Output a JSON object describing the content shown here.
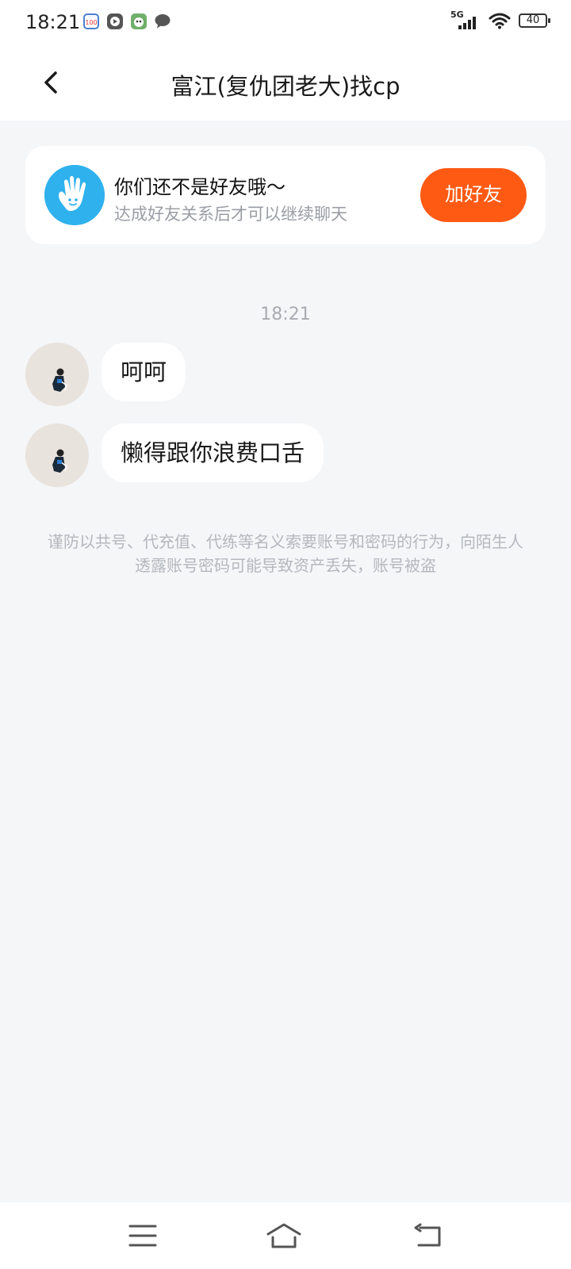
{
  "status_bar": {
    "time": "18:21",
    "network": "5G",
    "battery": "40",
    "notification_icons": [
      "calendar-app-icon",
      "video-play-icon",
      "game-app-icon",
      "message-bubble-icon"
    ]
  },
  "header": {
    "title": "富江(复仇团老大)找cp",
    "back_icon": "chevron-left-icon"
  },
  "friend_card": {
    "title": "你们还不是好友哦～",
    "subtitle": "达成好友关系后才可以继续聊天",
    "button_label": "加好友",
    "icon": "waving-hand-icon"
  },
  "chat": {
    "timestamp": "18:21",
    "messages": [
      {
        "text": "呵呵"
      },
      {
        "text": "懒得跟你浪费口舌"
      }
    ],
    "warning": "谨防以共号、代充值、代练等名义索要账号和密码的行为，向陌生人透露账号密码可能导致资产丢失，账号被盗"
  },
  "nav_bar": {
    "icons": [
      "menu-icon",
      "home-icon",
      "back-icon"
    ]
  },
  "colors": {
    "accent": "#ff5a14",
    "background": "#f4f6f8",
    "avatar_blue": "#2fb1ee"
  }
}
